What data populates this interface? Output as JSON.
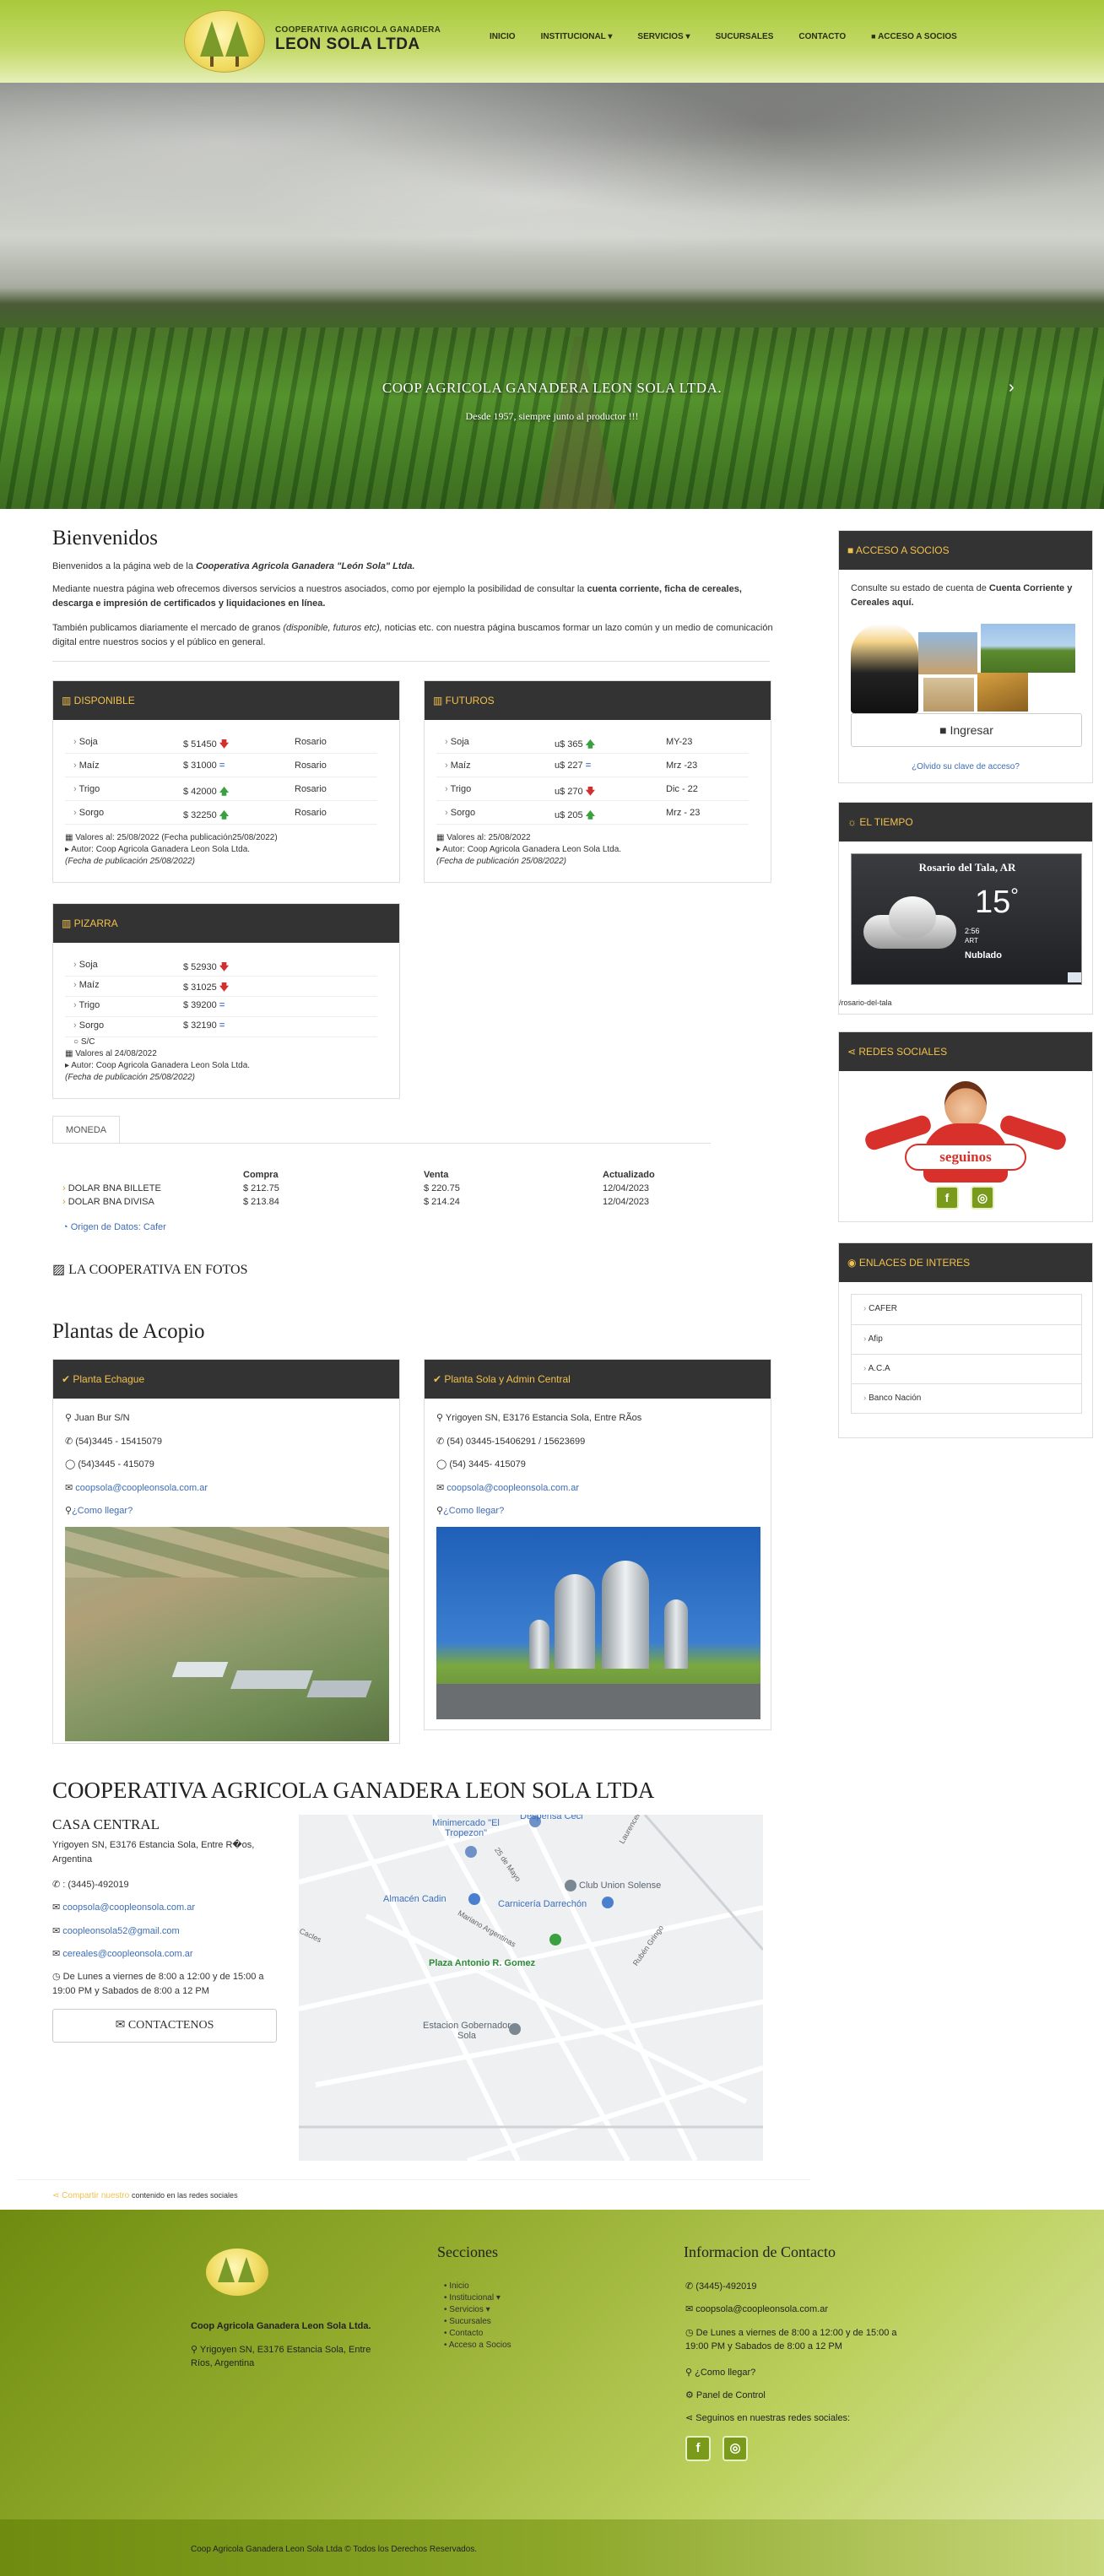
{
  "header": {
    "brand_small": "COOPERATIVA AGRICOLA GANADERA",
    "brand_big": "LEON SOLA LTDA",
    "nav": [
      "INICIO",
      "INSTITUCIONAL ▾",
      "SERVICIOS ▾",
      "SUCURSALES",
      "CONTACTO",
      "ACCESO A SOCIOS"
    ],
    "lock_glyph": "🔒"
  },
  "hero": {
    "title": "COOP AGRICOLA GANADERA LEON SOLA LTDA.",
    "subtitle": "Desde 1957, siempre junto al productor !!!",
    "next": "›",
    "dot_colors": [
      "#222222",
      "#f2c14e",
      "#f2c14e"
    ]
  },
  "welcome": {
    "heading": "Bienvenidos",
    "p1_a": "Bienvenidos a la página web de la ",
    "p1_b": "Cooperativa  Agricola Ganadera  \"León Sola\" Ltda.",
    "p2_a": "Mediante nuestra página web ofrecemos diversos servicios a nuestros asociados, como  por ejemplo la posibilidad  de consultar la ",
    "p2_b": "cuenta corriente, ficha de cereales, descarga e impresión de certificados y liquidaciones en línea.",
    "p3_a": "También publicamos diariamente el mercado de granos ",
    "p3_b": "(disponible, futuros etc),",
    "p3_c": "  noticias etc. con nuestra página buscamos  formar un lazo común y un medio de comunicación digital entre nuestros socios y el público en general."
  },
  "disponible": {
    "title": "DISPONIBLE",
    "rows": [
      {
        "name": "Soja",
        "price": "$ 51450",
        "trend": "down",
        "place": "Rosario"
      },
      {
        "name": "Maíz",
        "price": "$ 31000",
        "trend": "eq",
        "place": "Rosario"
      },
      {
        "name": "Trigo",
        "price": "$ 42000",
        "trend": "up",
        "place": "Rosario"
      },
      {
        "name": "Sorgo",
        "price": "$ 32250",
        "trend": "up",
        "place": "Rosario"
      }
    ],
    "date": "Valores al: 25/08/2022 (Fecha publicación25/08/2022)",
    "author": "Autor: Coop Agricola Ganadera Leon Sola Ltda.",
    "pub": "(Fecha de publicación 25/08/2022)"
  },
  "futuros": {
    "title": "FUTUROS",
    "rows": [
      {
        "name": "Soja",
        "price": "u$ 365",
        "trend": "up",
        "place": "MY-23"
      },
      {
        "name": "Maíz",
        "price": "u$ 227",
        "trend": "eq",
        "place": "Mrz -23"
      },
      {
        "name": "Trigo",
        "price": "u$ 270",
        "trend": "down",
        "place": "Dic - 22"
      },
      {
        "name": "Sorgo",
        "price": "u$ 205",
        "trend": "up",
        "place": "Mrz - 23"
      }
    ],
    "date": "Valores al: 25/08/2022",
    "author": "Autor: Coop Agricola Ganadera Leon Sola Ltda.",
    "pub": "(Fecha de publicación 25/08/2022)"
  },
  "pizarra": {
    "title": "PIZARRA",
    "rows": [
      {
        "name": "Soja",
        "price": "$ 52930",
        "trend": "down"
      },
      {
        "name": "Maíz",
        "price": "$ 31025",
        "trend": "down"
      },
      {
        "name": "Trigo",
        "price": "$ 39200",
        "trend": "eq"
      },
      {
        "name": "Sorgo",
        "price": "$ 32190",
        "trend": "eq"
      }
    ],
    "sc": "S/C",
    "date": "Valores al 24/08/2022",
    "author": "Autor: Coop Agricola Ganadera Leon Sola Ltda.",
    "pub": "(Fecha de publicación 25/08/2022)"
  },
  "moneda": {
    "tab": "MONEDA",
    "headers": [
      "Compra",
      "Venta",
      "Actualizado"
    ],
    "rows": [
      {
        "name": "DOLAR BNA BILLETE",
        "compra": "$ 212.75",
        "venta": "$ 220.75",
        "fecha": "12/04/2023"
      },
      {
        "name": "DOLAR BNA DIVISA",
        "compra": "$ 213.84",
        "venta": "$ 214.24",
        "fecha": "12/04/2023"
      }
    ],
    "source": "Origen de Datos: Cafer"
  },
  "fotos": {
    "title": "LA COOPERATIVA EN FOTOS"
  },
  "plantas": {
    "heading": "Plantas de Acopio",
    "items": [
      {
        "title": "Planta Echague",
        "address": "Juan Bur S/N",
        "phone": "(54)3445 - 15415079",
        "whatsapp": "(54)3445 - 415079",
        "email": "coopsola@coopleonsola.com.ar",
        "howto": "¿Como llegar?"
      },
      {
        "title": "Planta Sola y Admin Central",
        "address": "Yrigoyen SN, E3176 Estancia Sola, Entre RÃ­os",
        "phone": "(54) 03445-15406291 / 15623699",
        "whatsapp": "(54) 3445- 415079",
        "email": "coopsola@coopleonsola.com.ar",
        "howto": "¿Como llegar?"
      }
    ]
  },
  "contacto": {
    "heading": "COOPERATIVA AGRICOLA GANADERA LEON SOLA LTDA",
    "sub": "CASA CENTRAL",
    "address": "Yrigoyen SN, E3176 Estancia Sola, Entre R�os, Argentina",
    "phone": ": (3445)-492019",
    "email1": "coopsola@coopleonsola.com.ar",
    "email2": "coopleonsola52@gmail.com",
    "email3": "cereales@coopleonsola.com.ar",
    "hours": "De Lunes a viernes de 8:00 a 12:00 y de 15:00 a 19:00 PM y Sabados de 8:00 a 12 PM",
    "button": "CONTACTENOS"
  },
  "map": {
    "labels": [
      "Minimercado \"El Tropezon\"",
      "Despensa Ceci",
      "Almacén Cadin",
      "Club Union Solense",
      "Carnicería Darrechón",
      "Plaza Antonio R. Gomez",
      "Estacion Gobernador Sola",
      "25 de Mayo",
      "Mariano Argentinas",
      "Rubén Gringo",
      "Laurencena",
      "Cacles"
    ]
  },
  "share": {
    "link": "Compartir nuestro",
    "rest": "contenido en las redes sociales"
  },
  "sidebar": {
    "acceso": {
      "title": "ACCESO A SOCIOS",
      "text_a": "Consulte su estado de cuenta de ",
      "text_b": "Cuenta Corriente y Cereales aquí.",
      "button": "Ingresar",
      "forgot": "¿Olvido su clave de acceso?"
    },
    "tiempo": {
      "title": "EL TIEMPO",
      "city": "Rosario del Tala, AR",
      "temp": "15",
      "deg": "°",
      "time": "2:56",
      "tz": "ART",
      "cond": "Nublado",
      "slug": "/rosario-del-tala"
    },
    "redes": {
      "title": "REDES SOCIALES",
      "banner": "seguinos",
      "fb": "f",
      "ig": "◎"
    },
    "enlaces": {
      "title": "ENLACES DE INTERES",
      "items": [
        "CAFER",
        "Afip",
        "A.C.A",
        "Banco Nación"
      ]
    }
  },
  "footer": {
    "name": "Coop Agricola Ganadera Leon Sola Ltda.",
    "address": "Yrigoyen SN, E3176 Estancia Sola, Entre Ríos, Argentina",
    "secciones_title": "Secciones",
    "secciones": [
      "Inicio",
      "Institucional ▾",
      "Servicios ▾",
      "Sucursales",
      "Contacto",
      "Acceso a Socios"
    ],
    "contact_title": "Informacion de Contacto",
    "phone": "(3445)-492019",
    "email": "coopsola@coopleonsola.com.ar",
    "hours": "De Lunes a viernes de 8:00 a 12:00 y de 15:00 a 19:00 PM y Sabados de 8:00 a 12 PM",
    "howto": "¿Como llegar?",
    "panel": "Panel de Control",
    "follow": "Seguinos en nuestras redes sociales:",
    "copyright": "Coop Agricola Ganadera Leon Sola Ltda © Todos los Derechos Reservados."
  }
}
